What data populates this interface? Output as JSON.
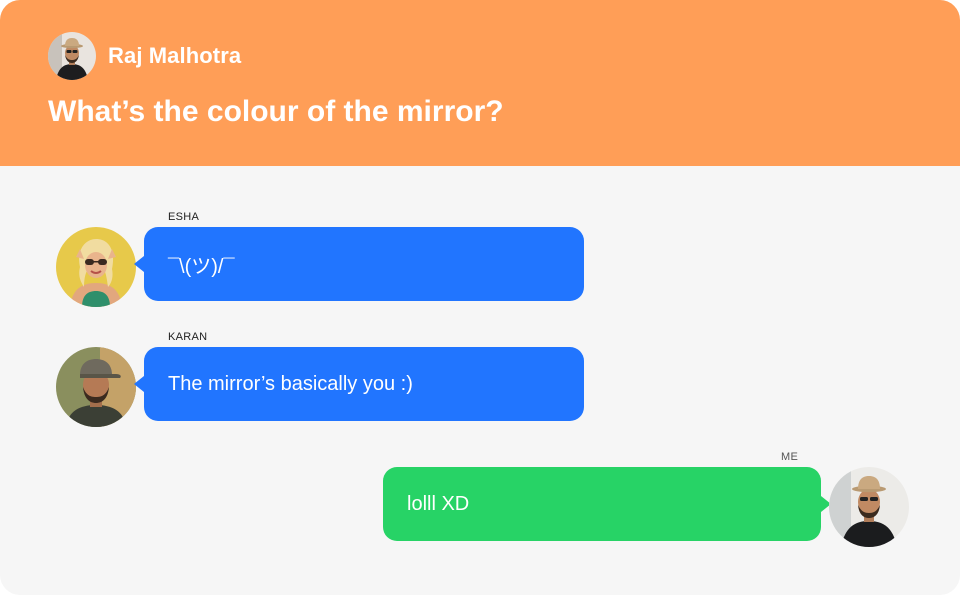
{
  "header": {
    "user_name": "Raj Malhotra",
    "title": "What’s the colour of the mirror?",
    "avatar_icon": "man-with-hat-avatar",
    "background": "#ff9e57"
  },
  "messages": [
    {
      "sender": "ESHA",
      "text": "¯\\(ツ)/¯",
      "side": "left",
      "color": "#2175ff",
      "avatar_icon": "woman-with-sunglasses-avatar"
    },
    {
      "sender": "KARAN",
      "text": "The mirror’s basically you :)",
      "side": "left",
      "color": "#2175ff",
      "avatar_icon": "man-with-cap-avatar"
    },
    {
      "sender": "ME",
      "text": "lolll XD",
      "side": "right",
      "color": "#27d366",
      "avatar_icon": "man-with-hat-avatar"
    }
  ]
}
